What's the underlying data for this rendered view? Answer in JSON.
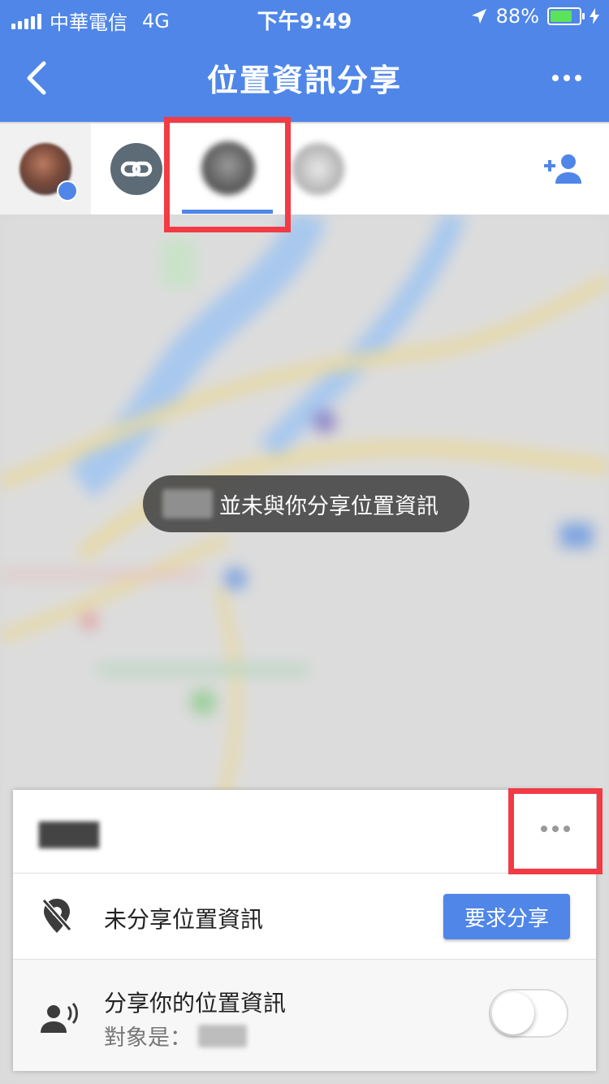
{
  "status_bar": {
    "carrier": "中華電信",
    "network": "4G",
    "time": "下午9:49",
    "battery": "88%",
    "battery_level": 0.88
  },
  "app_bar": {
    "title": "位置資訊分享",
    "back_icon": "chevron-left-icon",
    "more_icon": "more-horizontal-icon"
  },
  "tabs": {
    "items": [
      {
        "kind": "self-avatar"
      },
      {
        "kind": "link",
        "icon": "link-icon"
      },
      {
        "kind": "contact-avatar",
        "selected": true
      },
      {
        "kind": "contact-avatar"
      }
    ],
    "add_icon": "person-add-icon"
  },
  "map": {
    "toast_text": "並未與你分享位置資訊"
  },
  "sheet": {
    "more_icon": "more-horizontal-icon",
    "not_sharing_label": "未分享位置資訊",
    "request_button": "要求分享",
    "share_label": "分享你的位置資訊",
    "share_target_prefix": "對象是：",
    "share_toggle_on": false
  },
  "colors": {
    "primary": "#4f86e8",
    "highlight": "#f23b44",
    "toast_bg": "#464646"
  }
}
